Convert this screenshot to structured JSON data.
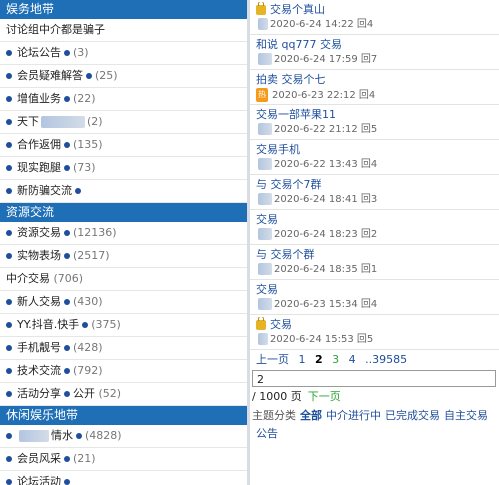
{
  "left": {
    "section1_title": "娱务地带",
    "section1_rows": [
      {
        "label": "讨论组中介都是骗子",
        "count": ""
      },
      {
        "label": "论坛公告",
        "count": "(3)"
      },
      {
        "label": "会员疑难解答",
        "count": "(25)"
      },
      {
        "label": "增值业务",
        "count": "(22)"
      },
      {
        "label": "天下",
        "count": "(2)"
      },
      {
        "label": "合作返佣",
        "count": "(135)"
      },
      {
        "label": "现实跑腿",
        "count": "(73)"
      },
      {
        "label": "新防骗交流",
        "count": ""
      }
    ],
    "section2_title": "资源交流",
    "section2_rows": [
      {
        "label": "资源交易",
        "count": "(12136)"
      },
      {
        "label": "实物表场",
        "count": "(2517)"
      },
      {
        "label": "中介交易",
        "count": "(706)"
      },
      {
        "label": "新人交易",
        "count": "(430)"
      },
      {
        "label": "YY.抖音.快手",
        "count": "(375)"
      },
      {
        "label": "手机靓号",
        "count": "(428)"
      },
      {
        "label": "技术交流",
        "count": "(792)"
      },
      {
        "label": "活动分享",
        "suffix": "公开",
        "count": "(52)"
      }
    ],
    "section3_title": "休闲娱乐地带",
    "section3_rows": [
      {
        "label": "情水",
        "count": "(4828)"
      },
      {
        "label": "会员风采",
        "count": "(21)"
      },
      {
        "label": "论坛活动",
        "count": ""
      }
    ]
  },
  "right": {
    "threads": [
      {
        "title": "交易个真山",
        "meta": "2020-6-24 14:22 回4",
        "lock": true
      },
      {
        "title": "和说 qq777 交易",
        "meta": "2020-6-24 17:59 回7"
      },
      {
        "title": "拍卖 交易个七",
        "meta": "2020-6-23 22:12 回4",
        "hot": "热"
      },
      {
        "title": "交易一部苹果11",
        "meta": "2020-6-22 21:12 回5"
      },
      {
        "title": "交易手机",
        "meta": "2020-6-22 13:43 回4"
      },
      {
        "title": "与 交易个7群",
        "meta": "2020-6-24 18:41 回3"
      },
      {
        "title": "交易",
        "meta": "2020-6-24 18:23 回2"
      },
      {
        "title": "与 交易个群",
        "meta": "2020-6-24 18:35 回1"
      },
      {
        "title": "交易",
        "meta": "2020-6-23 15:34 回4"
      },
      {
        "title": "交易",
        "meta": "2020-6-24 15:53 回5",
        "lock": true
      }
    ],
    "pager": {
      "prev": "上一页",
      "p1": "1",
      "p2": "2",
      "p3": "3",
      "p4": "4",
      "more": "..39585"
    },
    "goto_value": "2",
    "total": "/ 1000 页",
    "next": "下一页",
    "filter": {
      "label": "主题分类",
      "all": "全部",
      "o1": "中介进行中",
      "o2": "已完成交易",
      "o3": "自主交易",
      "o4": "公告"
    }
  }
}
